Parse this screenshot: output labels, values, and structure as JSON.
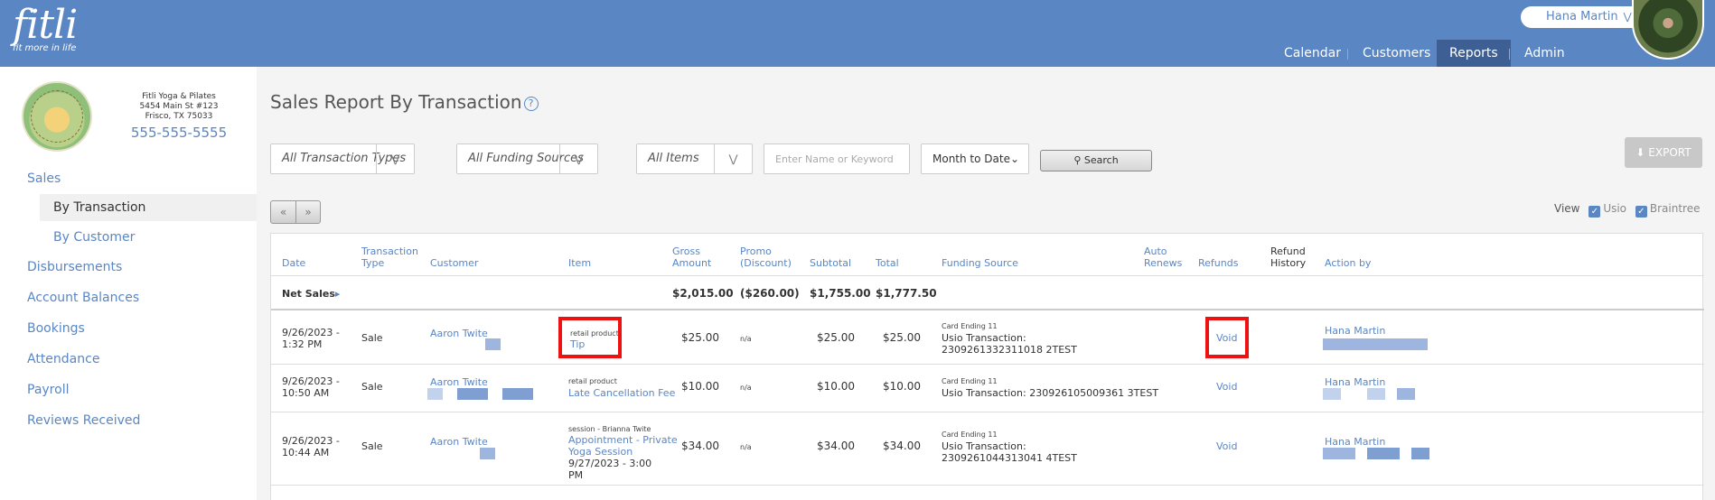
{
  "brand": {
    "logo": "fitli",
    "tagline": "fit more in life"
  },
  "user": {
    "name": "Hana Martin"
  },
  "nav": {
    "calendar": "Calendar",
    "customers": "Customers",
    "reports": "Reports",
    "admin": "Admin"
  },
  "studio": {
    "name": "Fitli Yoga & Pilates",
    "address1": "5454 Main St #123",
    "address2": "Frisco, TX 75033",
    "phone": "555-555-5555"
  },
  "sidebar": {
    "sales": "Sales",
    "by_transaction": "By Transaction",
    "by_customer": "By Customer",
    "disbursements": "Disbursements",
    "account_balances": "Account Balances",
    "bookings": "Bookings",
    "attendance": "Attendance",
    "payroll": "Payroll",
    "reviews": "Reviews Received"
  },
  "page": {
    "title": "Sales Report By Transaction"
  },
  "filters": {
    "transaction_types": "All Transaction Types",
    "funding_sources": "All Funding Sources",
    "items": "All Items",
    "keyword_placeholder": "Enter Name or Keyword",
    "period": "Month to Date",
    "search_label": "Search",
    "export_label": "EXPORT"
  },
  "pager": {
    "prev": "«",
    "next": "»"
  },
  "view": {
    "label": "View",
    "usio": "Usio",
    "braintree": "Braintree"
  },
  "table": {
    "headers": {
      "date": "Date",
      "type1": "Transaction",
      "type2": "Type",
      "customer": "Customer",
      "item": "Item",
      "gross1": "Gross",
      "gross2": "Amount",
      "promo1": "Promo",
      "promo2": "(Discount)",
      "subtotal": "Subtotal",
      "total": "Total",
      "funding": "Funding Source",
      "auto1": "Auto",
      "auto2": "Renews",
      "refunds": "Refunds",
      "refhist1": "Refund",
      "refhist2": "History",
      "action": "Action by"
    },
    "net": {
      "label": "Net Sales",
      "gross": "$2,015.00",
      "promo": "($260.00)",
      "subtotal": "$1,755.00",
      "total": "$1,777.50"
    },
    "rows": [
      {
        "date1": "9/26/2023 -",
        "date2": "1:32 PM",
        "type": "Sale",
        "customer": "Aaron Twite",
        "item_cat": "retail product",
        "item": "Tip",
        "gross": "$25.00",
        "promo": "n/a",
        "subtotal": "$25.00",
        "total": "$25.00",
        "card": "Card Ending 11",
        "funding1": "Usio Transaction:",
        "funding2": "2309261332311018 2TEST",
        "refund": "Void",
        "action": "Hana Martin"
      },
      {
        "date1": "9/26/2023 -",
        "date2": "10:50 AM",
        "type": "Sale",
        "customer": "Aaron Twite",
        "item_cat": "retail product",
        "item": "Late Cancellation Fee",
        "gross": "$10.00",
        "promo": "n/a",
        "subtotal": "$10.00",
        "total": "$10.00",
        "card": "Card Ending 11",
        "funding1": "Usio Transaction: 230926105009361 3TEST",
        "funding2": "",
        "refund": "Void",
        "action": "Hana Martin"
      },
      {
        "date1": "9/26/2023 -",
        "date2": "10:44 AM",
        "type": "Sale",
        "customer": "Aaron Twite",
        "item_cat": "session - Brianna Twite",
        "item": "Appointment - Private",
        "item2": "Yoga Session",
        "item3": "9/27/2023 - 3:00",
        "item4": "PM",
        "gross": "$34.00",
        "promo": "n/a",
        "subtotal": "$34.00",
        "total": "$34.00",
        "card": "Card Ending 11",
        "funding1": "Usio Transaction:",
        "funding2": "2309261044313041 4TEST",
        "refund": "Void",
        "action": "Hana Martin"
      }
    ]
  }
}
